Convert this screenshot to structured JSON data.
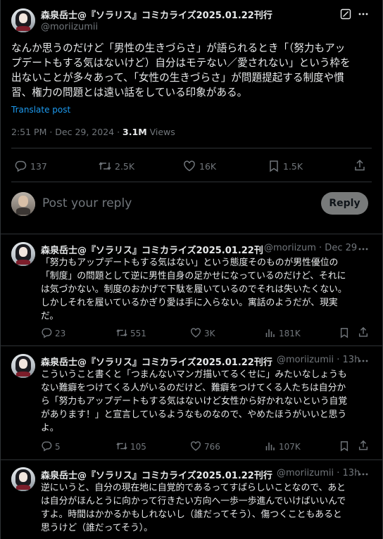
{
  "main_post": {
    "author_name": "森泉岳士@『ソラリス』コミカライズ2025.01.22刊行",
    "author_handle": "@moriizumii",
    "text_lines": [
      "なんか思うのだけど「男性の生きづらさ」が語られるとき「（努力もアッ",
      "プデートもする気はないけど）自分はモテない／愛されない」という枠を",
      "出ないことが多々あって、「女性の生きづらさ」が問題提起する制度や慣",
      "習、権力の問題とは遠い話をしている印象がある。"
    ],
    "translate_label": "Translate post",
    "time": "2:51 PM · Dec 29, 2024 · ",
    "views_count": "3.1M",
    "views_label": " Views",
    "stats": {
      "replies": "137",
      "reposts": "2.5K",
      "likes": "16K",
      "bookmarks": "1.5K"
    }
  },
  "reply_box": {
    "placeholder": "Post your reply",
    "button_label": "Reply"
  },
  "replies": [
    {
      "author_name": "森泉岳士@『ソラリス』コミカライズ2025.01.22刊",
      "handle_time": "@moriizum · Dec 29",
      "text_lines": [
        "「努力もアップデートもする気はない」という態度そのものが男性優位の",
        "「制度」の問題として逆に男性自身の足かせになっているのだけど、それに",
        "は気づかない。制度のおかげで下駄を履いているのでそれは失いたくない。",
        "しかしそれを履いているかぎり愛は手に入らない。寓話のようだが、現実",
        "だ。"
      ],
      "stats": {
        "replies": "23",
        "reposts": "551",
        "likes": "3K",
        "views": "181K"
      }
    },
    {
      "author_name": "森泉岳士@『ソラリス』コミカライズ2025.01.22刊行",
      "handle_time": "@moriizumii · 13h",
      "text_lines": [
        "こういうこと書くと「つまんないマンガ描いてるくせに」みたいなしょうも",
        "ない難癖をつけてくる人がいるのだけど、難癖をつけてくる人たちは自分か",
        "ら「努力もアップデートもする気はないけど女性から好かれないという自覚",
        "があります！」と宣言しているようなものなので、やめたほうがいいと思う",
        "よ。"
      ],
      "stats": {
        "replies": "5",
        "reposts": "105",
        "likes": "766",
        "views": "107K"
      }
    },
    {
      "author_name": "森泉岳士@『ソラリス』コミカライズ2025.01.22刊行",
      "handle_time": "@moriizumii · 13h",
      "text_lines": [
        "逆にいうと、自分の現在地に自覚的であるってすばらしいことなので、あと",
        "は自分がほんとうに向かって行きたい方向へ一歩一歩進んでいけばいいんで",
        "すよ。時間はかかるかもしれないし（誰だってそう）、傷つくこともあると",
        "思うけど（誰だってそう）。"
      ]
    }
  ],
  "icons": [
    "grok-icon",
    "more-icon",
    "reply-icon",
    "repost-icon",
    "like-icon",
    "bookmark-icon",
    "share-icon",
    "views-icon"
  ]
}
